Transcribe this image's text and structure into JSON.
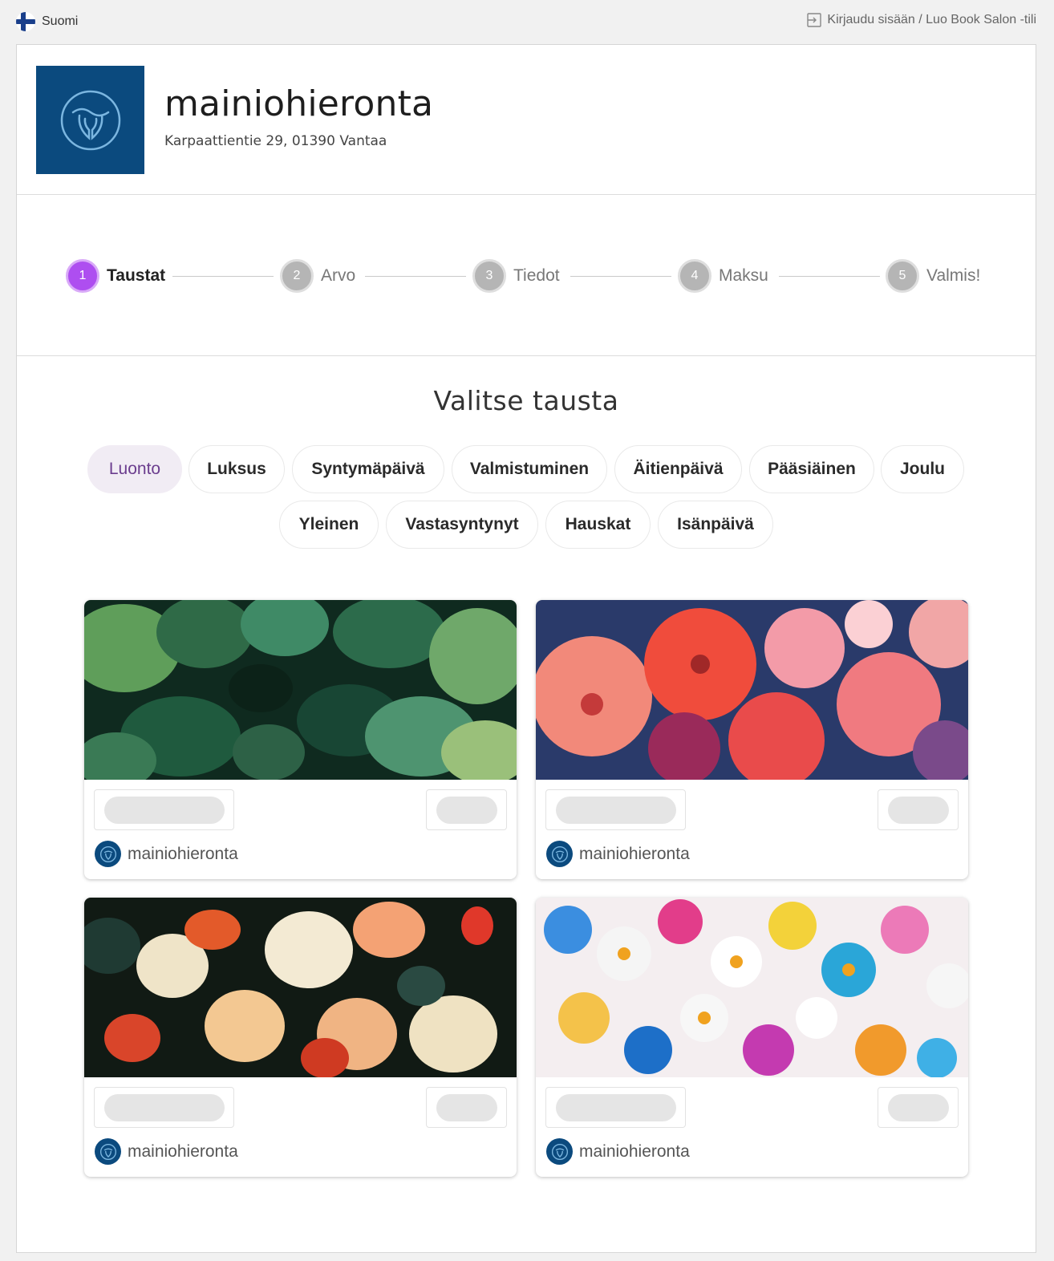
{
  "topbar": {
    "language": "Suomi",
    "login": "Kirjaudu sisään / Luo Book Salon -tili"
  },
  "salon": {
    "name": "mainiohieronta",
    "address": "Karpaattientie 29, 01390 Vantaa",
    "logo_color": "#0b4a7e"
  },
  "steps": [
    {
      "number": "1",
      "label": "Taustat",
      "active": true
    },
    {
      "number": "2",
      "label": "Arvo",
      "active": false
    },
    {
      "number": "3",
      "label": "Tiedot",
      "active": false
    },
    {
      "number": "4",
      "label": "Maksu",
      "active": false
    },
    {
      "number": "5",
      "label": "Valmis!",
      "active": false
    }
  ],
  "accent_color": "#ae4ef0",
  "section_title": "Valitse tausta",
  "categories": [
    {
      "label": "Luonto",
      "selected": true
    },
    {
      "label": "Luksus"
    },
    {
      "label": "Syntymäpäivä"
    },
    {
      "label": "Valmistuminen"
    },
    {
      "label": "Äitienpäivä"
    },
    {
      "label": "Pääsiäinen"
    },
    {
      "label": "Joulu"
    },
    {
      "label": "Yleinen"
    },
    {
      "label": "Vastasyntynyt"
    },
    {
      "label": "Hauskat"
    },
    {
      "label": "Isänpäivä"
    }
  ],
  "cards": [
    {
      "image": "tropical-leaves",
      "brand": "mainiohieronta"
    },
    {
      "image": "hibiscus-flowers",
      "brand": "mainiohieronta"
    },
    {
      "image": "lilies-on-dark",
      "brand": "mainiohieronta"
    },
    {
      "image": "colorful-daisies",
      "brand": "mainiohieronta"
    }
  ]
}
